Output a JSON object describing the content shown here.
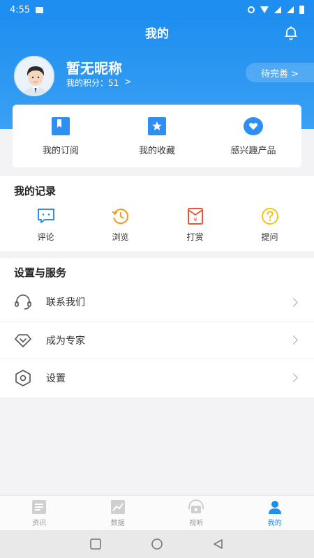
{
  "status_bar": {
    "time": "4:55"
  },
  "header": {
    "title": "我的"
  },
  "profile": {
    "nickname": "暂无昵称",
    "points_label": "我的积分：",
    "points_value": "51",
    "points_arrow": ">",
    "pending": "待完善 >"
  },
  "quick": [
    {
      "label": "我的订阅",
      "icon": "bookmark-icon"
    },
    {
      "label": "我的收藏",
      "icon": "star-icon"
    },
    {
      "label": "感兴趣产品",
      "icon": "heart-icon"
    }
  ],
  "records": {
    "title": "我的记录",
    "items": [
      {
        "label": "评论",
        "icon": "comment-icon",
        "color": "#2f8ff0"
      },
      {
        "label": "浏览",
        "icon": "history-icon",
        "color": "#f0a028"
      },
      {
        "label": "打赏",
        "icon": "reward-icon",
        "color": "#e8553a"
      },
      {
        "label": "提问",
        "icon": "question-icon",
        "color": "#f2c318"
      }
    ]
  },
  "settings": {
    "title": "设置与服务",
    "items": [
      {
        "label": "联系我们",
        "icon": "headset-icon"
      },
      {
        "label": "成为专家",
        "icon": "diamond-icon"
      },
      {
        "label": "设置",
        "icon": "hexagon-settings-icon"
      }
    ]
  },
  "tabs": [
    {
      "label": "资讯",
      "icon": "news-icon",
      "active": false
    },
    {
      "label": "数据",
      "icon": "chart-icon",
      "active": false
    },
    {
      "label": "视听",
      "icon": "video-icon",
      "active": false
    },
    {
      "label": "我的",
      "icon": "user-icon",
      "active": true
    }
  ],
  "colors": {
    "primary": "#1e8ef0",
    "background": "#f3f3f5"
  }
}
